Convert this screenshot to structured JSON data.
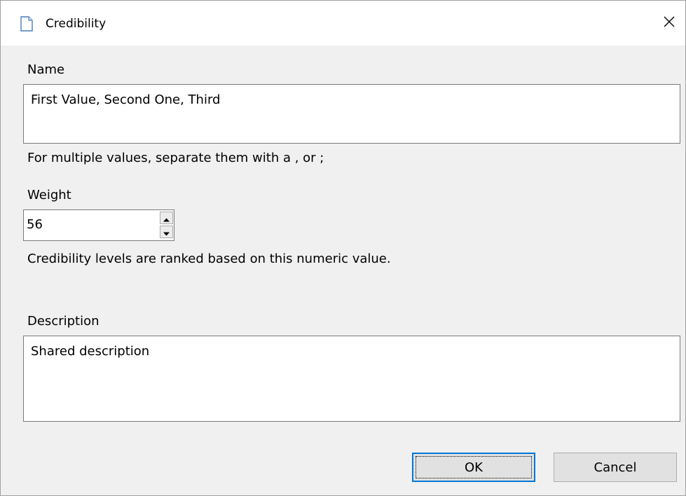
{
  "window": {
    "title": "Credibility",
    "icon": "document-icon",
    "close_glyph": "✕"
  },
  "form": {
    "name_label": "Name",
    "name_value": "First Value, Second One, Third",
    "name_hint": "For multiple values, separate them with a , or ;",
    "weight_label": "Weight",
    "weight_value": "56",
    "weight_hint": "Credibility levels are ranked based on this numeric value.",
    "description_label": "Description",
    "description_value": "Shared description"
  },
  "buttons": {
    "ok_label": "OK",
    "cancel_label": "Cancel"
  },
  "colors": {
    "accent": "#0078d7",
    "background": "#f0f0f0"
  }
}
